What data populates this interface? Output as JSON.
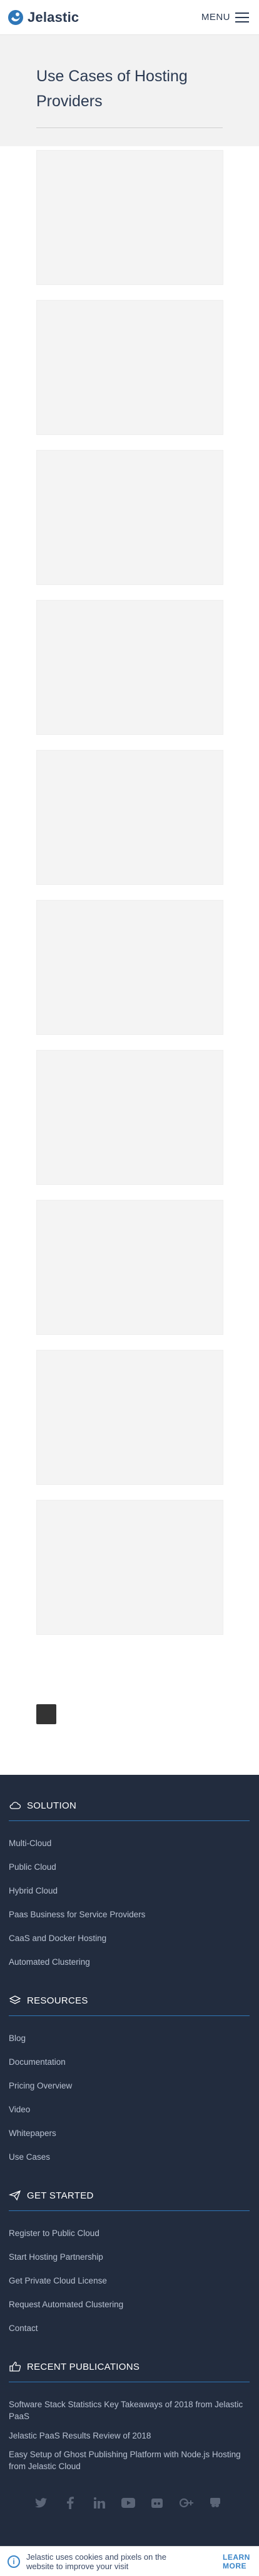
{
  "header": {
    "brand": "Jelastic",
    "menu_label": "MENU"
  },
  "hero": {
    "title": "Use Cases of Hosting Providers"
  },
  "cards_count_visible": 10,
  "footer": {
    "sections": [
      {
        "title": "SOLUTION",
        "icon": "cloud-icon",
        "links": [
          "Multi-Cloud",
          "Public Cloud",
          "Hybrid Cloud",
          "Paas Business for Service Providers",
          "CaaS and Docker Hosting",
          "Automated Clustering"
        ]
      },
      {
        "title": "RESOURCES",
        "icon": "layers-icon",
        "links": [
          "Blog",
          "Documentation",
          "Pricing Overview",
          "Video",
          "Whitepapers",
          "Use Cases"
        ]
      },
      {
        "title": "GET STARTED",
        "icon": "paper-plane-icon",
        "links": [
          "Register to Public Cloud",
          "Start Hosting Partnership",
          "Get Private Cloud License",
          "Request Automated Clustering",
          "Contact"
        ]
      },
      {
        "title": "RECENT PUBLICATIONS",
        "icon": "thumbs-up-icon",
        "links": [
          "Software Stack Statistics Key Takeaways of 2018 from Jelastic PaaS",
          "Jelastic PaaS Results Review of 2018",
          "Easy Setup of Ghost Publishing Platform with Node.js Hosting from Jelastic Cloud"
        ]
      }
    ],
    "socials": [
      "twitter-icon",
      "facebook-icon",
      "linkedin-icon",
      "youtube-icon",
      "github-icon",
      "google-plus-icon",
      "slideshare-icon"
    ]
  },
  "cookie": {
    "text": "Jelastic uses cookies and pixels on the website to improve your visit",
    "button": "LEARN MORE"
  },
  "colors": {
    "accent": "#2f77b8",
    "footer_bg": "#222c3e",
    "hero_bg": "#f2f2f2"
  }
}
